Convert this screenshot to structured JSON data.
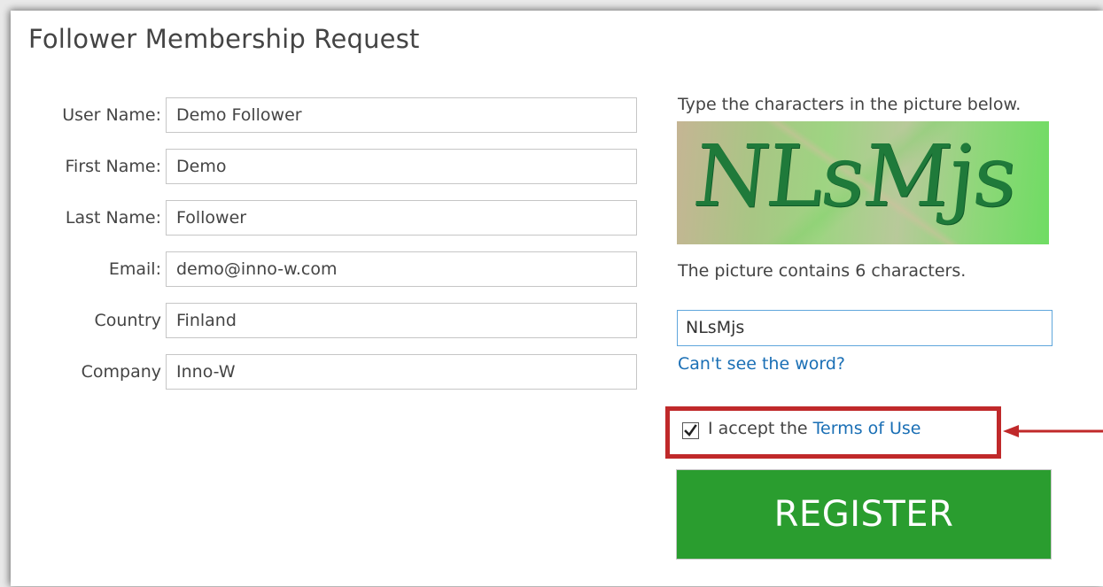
{
  "form": {
    "title": "Follower Membership Request",
    "fields": [
      {
        "label": "User Name:",
        "value": "Demo Follower"
      },
      {
        "label": "First Name:",
        "value": "Demo"
      },
      {
        "label": "Last Name:",
        "value": "Follower"
      },
      {
        "label": "Email:",
        "value": "demo@inno-w.com"
      },
      {
        "label": "Country",
        "value": "Finland"
      },
      {
        "label": "Company",
        "value": "Inno-W"
      }
    ]
  },
  "captcha": {
    "prompt": "Type the characters in the picture below.",
    "image_text": "NLsMjs",
    "count_text": "The picture contains 6 characters.",
    "input_value": "NLsMjs",
    "cant_see_link": "Can't see the word?"
  },
  "terms": {
    "checked": true,
    "prefix": "I accept the",
    "link": "Terms of Use",
    "highlight_color": "#c0292a"
  },
  "register_button": {
    "label": "REGISTER",
    "color": "#2a9d2f"
  },
  "icons": {
    "checkbox": "checkmark-icon",
    "annotation": "arrow-left-icon"
  }
}
